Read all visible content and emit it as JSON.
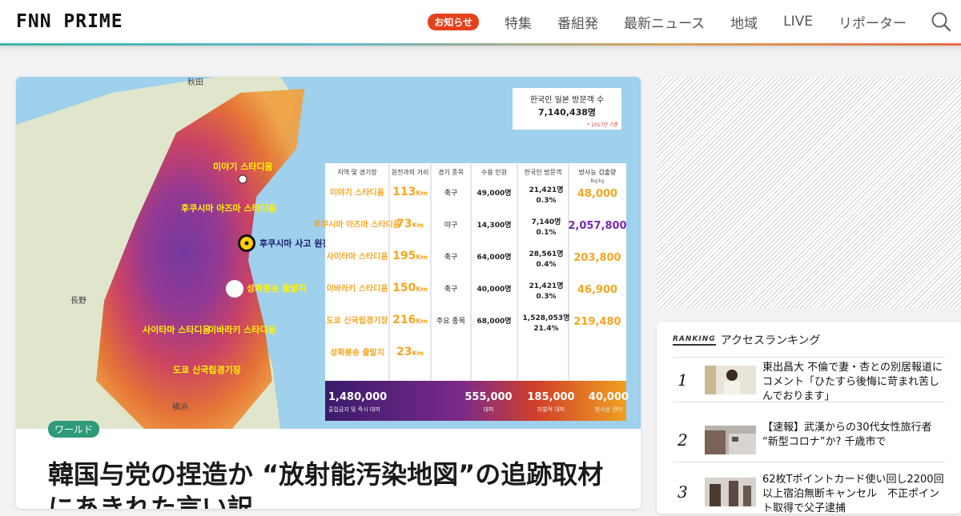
{
  "header": {
    "logo": "FNN PRIME",
    "notice_badge": "お知らせ",
    "nav": [
      "特集",
      "番組発",
      "最新ニュース",
      "地域",
      "LIVE",
      "リポーター"
    ],
    "search_icon": "search-icon"
  },
  "article": {
    "category": "ワールド",
    "headline": "韓国与党の捏造か “放射能汚染地図”の追跡取材にあきれた言い訳"
  },
  "map": {
    "labels": {
      "miyagi": "미야기 스타디움",
      "fukushima_stadium": "후쿠시마 아즈마 스타디움",
      "nuclear": "후쿠시마 사고 원전",
      "torch": "성화봉송 출발지",
      "saitama": "사이타마 스타디움",
      "ibaraki": "이바라키 스타디움",
      "tokyo": "도쿄 신국립경기장"
    },
    "visitors_box": {
      "title": "한국인 일본 방문객 수",
      "value": "7,140,438명",
      "note": "* 2017년 기준"
    },
    "table_headers": [
      "지역 및 경기장",
      "원전과의 거리",
      "경기 종목",
      "수용 인원",
      "한국인 방문객",
      "방사능 검출량"
    ],
    "table_unit": "Bq/kg",
    "rows": [
      {
        "venue": "미야기 스타디움",
        "distance": "113",
        "event": "축구",
        "capacity": "49,000명",
        "visitors": "21,421명",
        "share": "0.3%",
        "radiation": "48,000"
      },
      {
        "venue": "후쿠시마 아즈마 스타디움",
        "distance": "73",
        "event": "야구",
        "capacity": "14,300명",
        "visitors": "7,140명",
        "share": "0.1%",
        "radiation": "2,057,800"
      },
      {
        "venue": "사이타마 스타디움",
        "distance": "195",
        "event": "축구",
        "capacity": "64,000명",
        "visitors": "28,561명",
        "share": "0.4%",
        "radiation": "203,800"
      },
      {
        "venue": "이바라키 스타디움",
        "distance": "150",
        "event": "축구",
        "capacity": "40,000명",
        "visitors": "21,421명",
        "share": "0.3%",
        "radiation": "46,900"
      },
      {
        "venue": "도쿄 신국립경기장",
        "distance": "216",
        "event": "주요 종목",
        "capacity": "68,000명",
        "visitors": "1,528,053명",
        "share": "21.4%",
        "radiation": "219,480"
      },
      {
        "venue": "성화봉송 출발지",
        "distance": "23",
        "event": "",
        "capacity": "",
        "visitors": "",
        "share": "",
        "radiation": ""
      }
    ],
    "km_unit": "Km",
    "footer": [
      {
        "value": "1,480,000",
        "label": "출입금지 및 즉시 대피"
      },
      {
        "value": "555,000",
        "label": "대피"
      },
      {
        "value": "185,000",
        "label": "자발적 대피"
      },
      {
        "value": "40,000",
        "label": "방사선 관리"
      }
    ]
  },
  "ranking": {
    "tag": "RANKING",
    "title": "アクセスランキング",
    "items": [
      {
        "rank": "1",
        "text": "東出昌大 不倫で妻・杏との別居報道にコメント「ひたすら後悔に苛まれ苦しんでおります」"
      },
      {
        "rank": "2",
        "text": "【速報】武漢からの30代女性旅行者 “新型コロナ”か? 千歳市で"
      },
      {
        "rank": "3",
        "text": "62枚Tポイントカード使い回し2200回以上宿泊無断キャンセル　不正ポイント取得で父子逮捕"
      }
    ]
  },
  "colors": {
    "accent_red": "#e5411c",
    "category_green": "#2d9a7a",
    "radiation_orange": "#f5a623"
  }
}
